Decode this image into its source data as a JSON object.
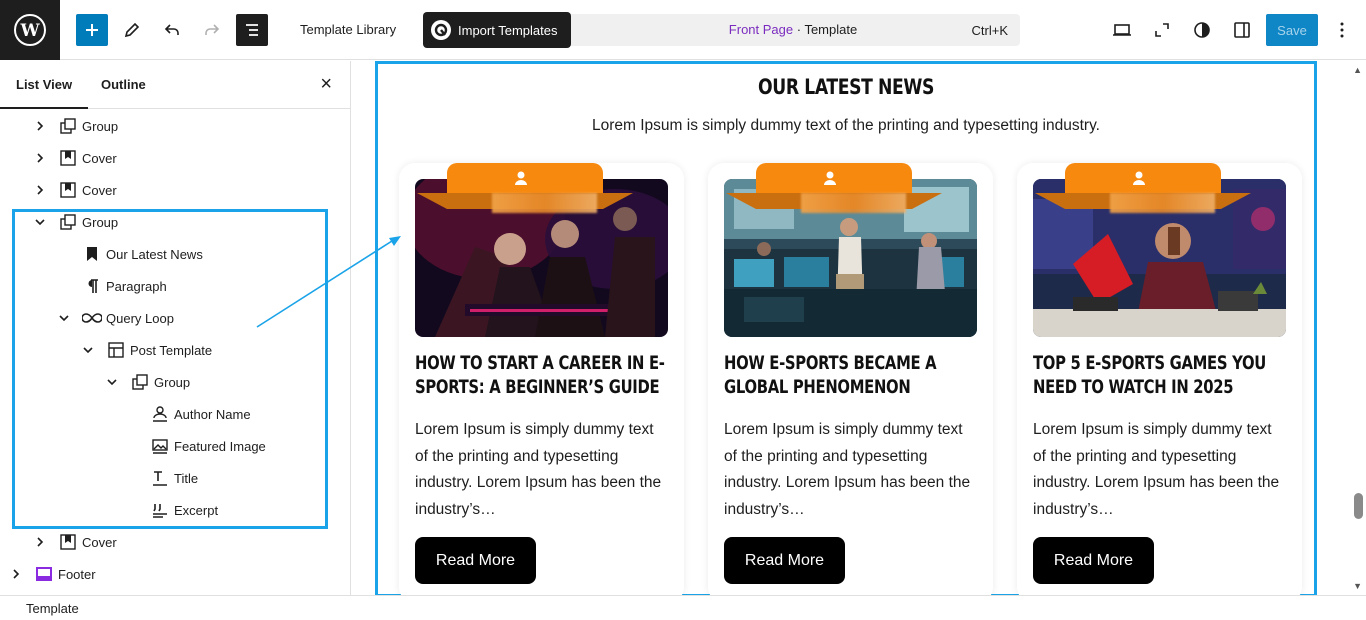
{
  "toolbar": {
    "template_library_label": "Template Library",
    "import_templates_label": "Import Templates",
    "doc_page": "Front Page",
    "doc_separator": " · ",
    "doc_type": "Template",
    "shortcut": "Ctrl+K",
    "save_label": "Save"
  },
  "sidebar": {
    "tabs": [
      "List View",
      "Outline"
    ],
    "active_tab": "List View",
    "items": [
      {
        "label": "Group",
        "icon": "group-icon",
        "expanded": false
      },
      {
        "label": "Cover",
        "icon": "cover-icon",
        "expanded": false
      },
      {
        "label": "Cover",
        "icon": "cover-icon",
        "expanded": false
      },
      {
        "label": "Group",
        "icon": "group-icon",
        "expanded": true
      },
      {
        "label": "Our Latest News",
        "icon": "heading-bookmark-icon"
      },
      {
        "label": "Paragraph",
        "icon": "paragraph-icon"
      },
      {
        "label": "Query Loop",
        "icon": "loop-icon",
        "expanded": true
      },
      {
        "label": "Post Template",
        "icon": "layout-icon",
        "expanded": true
      },
      {
        "label": "Group",
        "icon": "group-icon",
        "expanded": true
      },
      {
        "label": "Author Name",
        "icon": "author-icon"
      },
      {
        "label": "Featured Image",
        "icon": "image-icon"
      },
      {
        "label": "Title",
        "icon": "title-icon"
      },
      {
        "label": "Excerpt",
        "icon": "excerpt-icon"
      },
      {
        "label": "Cover",
        "icon": "cover-icon",
        "expanded": false
      },
      {
        "label": "Footer",
        "icon": "footer-icon",
        "expanded": false
      }
    ]
  },
  "canvas": {
    "heading": "OUR LATEST NEWS",
    "subheading": "Lorem Ipsum is simply dummy text of the printing and typesetting industry.",
    "posts": [
      {
        "title": "How to Start a Career in E-Sports: A Beginner’s Guide",
        "excerpt": "Lorem Ipsum is simply dummy text of the printing and typesetting industry. Lorem Ipsum has been the industry’s…",
        "button": "Read More"
      },
      {
        "title": "How E-Sports Became a Global Phenomenon",
        "excerpt": "Lorem Ipsum is simply dummy text of the printing and typesetting industry. Lorem Ipsum has been the industry’s…",
        "button": "Read More"
      },
      {
        "title": "Top 5 E-Sports Games You Need to Watch in 2025",
        "excerpt": "Lorem Ipsum is simply dummy text of the printing and typesetting industry. Lorem Ipsum has been the industry’s…",
        "button": "Read More"
      }
    ]
  },
  "statusbar": {
    "label": "Template"
  },
  "colors": {
    "accent": "#007cba",
    "selection": "#1aa3e8",
    "badge": "#f7890f",
    "doc_page": "#7b2cbf"
  }
}
